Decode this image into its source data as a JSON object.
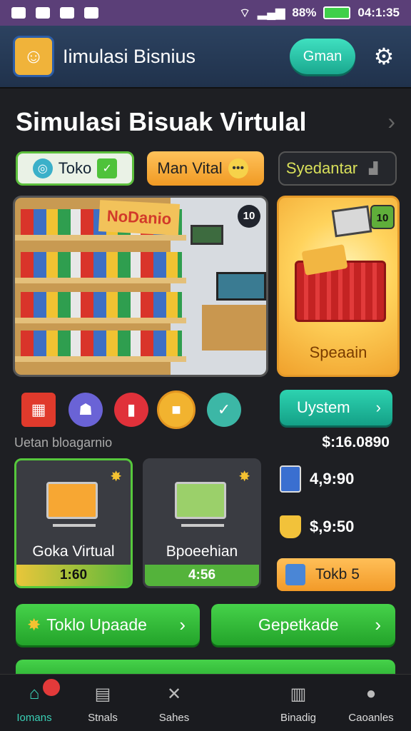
{
  "status_bar": {
    "battery": "88%",
    "time": "04:1:35"
  },
  "header": {
    "title": "Iimulasi Bisnius",
    "action_label": "Gman"
  },
  "main": {
    "headline": "Simulasi Bisuak Virtulal",
    "chips": [
      "Toko",
      "Man Vital",
      "Syedantar"
    ],
    "store_sign": "NoDanio",
    "store_badge": "10",
    "special_badge": "10",
    "special_label": "Speaain",
    "system_button": "Uystem",
    "caption": "Uetan bloagarnio",
    "balance": "$:16.0890",
    "cards": [
      {
        "title": "Goka Virtual",
        "price": "1:60"
      },
      {
        "title": "Bpoeehian",
        "price": "4:56"
      }
    ],
    "stats": [
      "4,9:90",
      "$,9:50"
    ],
    "orange_button": "Tokb 5",
    "action_buttons": [
      "Toklo Upaade",
      "Gepetkade"
    ]
  },
  "nav": {
    "items": [
      "Iomans",
      "Stnals",
      "Sahes",
      "Binadig",
      "Caoanles"
    ]
  }
}
